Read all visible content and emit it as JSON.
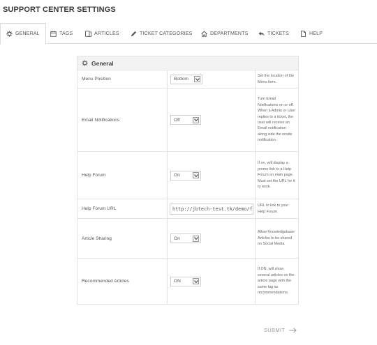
{
  "page": {
    "title": "SUPPORT CENTER SETTINGS"
  },
  "tabs": [
    {
      "label": "GENERAL",
      "icon": "gear-icon",
      "active": true
    },
    {
      "label": "TAGS",
      "icon": "calendar-icon",
      "active": false
    },
    {
      "label": "ARTICLES",
      "icon": "documents-icon",
      "active": false
    },
    {
      "label": "TICKET CATEGORIES",
      "icon": "pencil-icon",
      "active": false
    },
    {
      "label": "DEPARTMENTS",
      "icon": "home-icon",
      "active": false
    },
    {
      "label": "TICKETS",
      "icon": "reply-icon",
      "active": false
    },
    {
      "label": "HELP",
      "icon": "file-icon",
      "active": false
    }
  ],
  "card": {
    "title": "General",
    "icon": "gear-icon"
  },
  "settings": [
    {
      "label": "Menu Position",
      "control": "select",
      "value": "Bottom",
      "help": "Set the location of the Menu Item."
    },
    {
      "label": "Email Notifications",
      "control": "select",
      "value": "Off",
      "help": "Turn Email Notifications on or off. When a Admin or User replies to a ticket, the user will receive an Email notification along side the onsite notification."
    },
    {
      "label": "Help Forum",
      "control": "select",
      "value": "On",
      "help": "If on, will display a promo link to a Help Forum on main page. Must set the URL for it to work."
    },
    {
      "label": "Help Forum URL",
      "control": "text",
      "value": "http://jbtech-test.tk/demo/fo",
      "help": "URL to link to your Help Forum"
    },
    {
      "label": "Article Sharing",
      "control": "select",
      "value": "On",
      "help": "Allow Knowledgebase Articles to be shared on Social Media"
    },
    {
      "label": "Recommended Articles",
      "control": "select",
      "value": "ON",
      "help": "If ON, will show several articles on the article page with the same tag as recommendations."
    }
  ],
  "footer": {
    "submit_label": "SUBMIT"
  },
  "colors": {
    "border": "#e2e2e2",
    "header_bg": "#f3f3f3",
    "text": "#555555",
    "muted": "#9a9a9a"
  }
}
